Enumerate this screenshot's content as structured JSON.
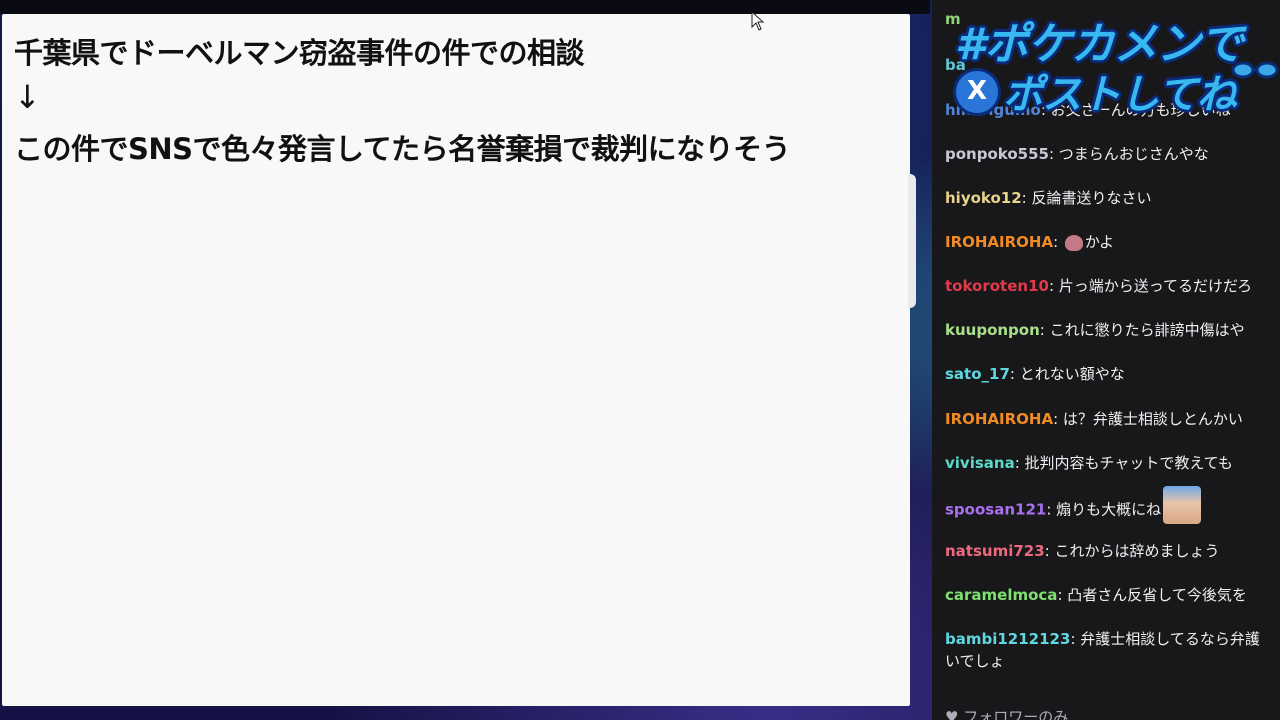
{
  "topic": {
    "line1": "千葉県でドーベルマン窃盗事件の件での相談",
    "line2": "↓",
    "line3": "この件でSNSで色々発言してたら名誉棄損で裁判になりそう"
  },
  "overlay": {
    "hashtag_line1": "#ポケカメンで",
    "hashtag_line2": "ポストしてね",
    "x_logo": "X"
  },
  "chat": {
    "messages": [
      {
        "user": "m",
        "text": "",
        "color": "#8fd37a"
      },
      {
        "user": "ba",
        "text": "",
        "color": "#62c8d7"
      },
      {
        "user": "hikarigumo",
        "text": "お父さーんの方も珍しいね",
        "color": "#4f86d8"
      },
      {
        "user": "ponpoko555",
        "text": "つまらんおじさんやな",
        "color": "#c8c8d4"
      },
      {
        "user": "hiyoko12",
        "text": "反論書送りなさい",
        "color": "#e7d38a"
      },
      {
        "user": "IROHAIROHA",
        "text": "かよ",
        "color": "#f08a24"
      },
      {
        "user": "tokoroten10",
        "text": "片っ端から送ってるだけだろ",
        "color": "#e23a4a"
      },
      {
        "user": "kuuponpon",
        "text": "これに懲りたら誹謗中傷はや",
        "color": "#a8e08a"
      },
      {
        "user": "sato_17",
        "text": "とれない額やな",
        "color": "#5fd8e0"
      },
      {
        "user": "IROHAIROHA",
        "text": "は？弁護士相談しとんかい",
        "color": "#f08a24"
      },
      {
        "user": "vivisana",
        "text": "批判内容もチャットで教えても",
        "color": "#5fd8c8"
      },
      {
        "user": "spoosan121",
        "text": "煽りも大概にね",
        "color": "#a970f0"
      },
      {
        "user": "natsumi723",
        "text": "これからは辞めましょう",
        "color": "#ec6a7e"
      },
      {
        "user": "caramelmoca",
        "text": "凸者さん反省して今後気を",
        "color": "#7ee070"
      },
      {
        "user": "bambi1212123",
        "text": "弁護士相談してるなら弁護",
        "text2": "いでしょ",
        "color": "#5fd8e0"
      }
    ],
    "footer": "フォロワーのみ"
  },
  "colors": {
    "panel_bg": "#f8f8f8",
    "chat_bg": "#18181b",
    "overlay_blue": "#38b8f0"
  }
}
